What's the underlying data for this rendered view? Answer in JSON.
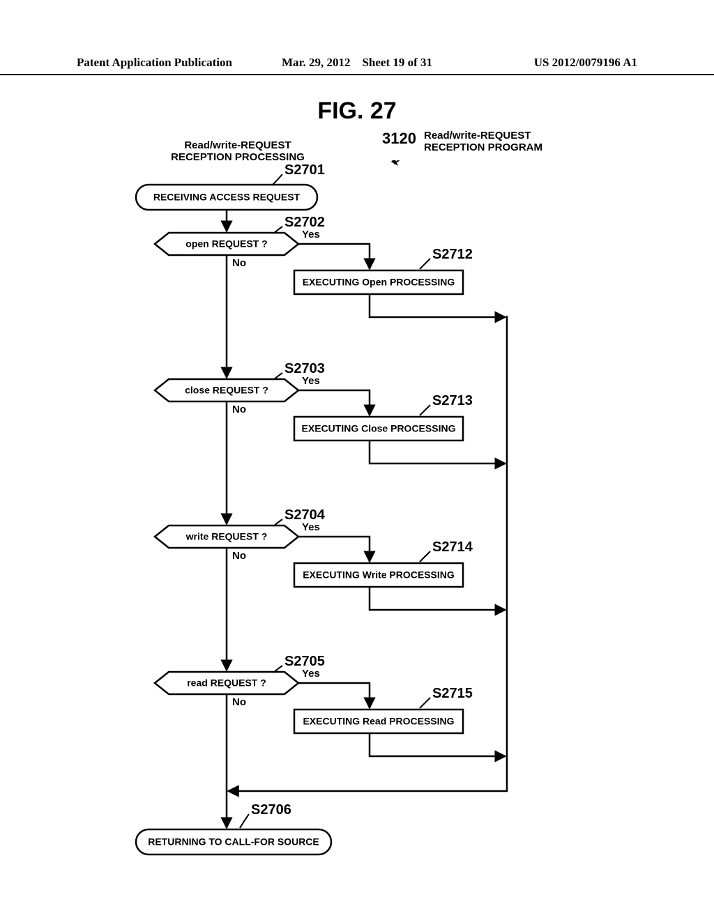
{
  "header": {
    "pub_type": "Patent Application Publication",
    "date": "Mar. 29, 2012",
    "sheet": "Sheet 19 of 31",
    "pub_no": "US 2012/0079196 A1"
  },
  "figure_title": "FIG. 27",
  "processing_title": "Read/write-REQUEST RECEPTION PROCESSING",
  "ref_number": "3120",
  "program_title": "Read/write-REQUEST RECEPTION PROGRAM",
  "steps": {
    "s2701": {
      "label": "S2701",
      "text": "RECEIVING ACCESS REQUEST"
    },
    "s2702": {
      "label": "S2702",
      "text": "open REQUEST ?"
    },
    "s2703": {
      "label": "S2703",
      "text": "close REQUEST ?"
    },
    "s2704": {
      "label": "S2704",
      "text": "write REQUEST ?"
    },
    "s2705": {
      "label": "S2705",
      "text": "read REQUEST ?"
    },
    "s2706": {
      "label": "S2706",
      "text": "RETURNING TO CALL-FOR SOURCE"
    },
    "s2712": {
      "label": "S2712",
      "text": "EXECUTING Open PROCESSING"
    },
    "s2713": {
      "label": "S2713",
      "text": "EXECUTING Close PROCESSING"
    },
    "s2714": {
      "label": "S2714",
      "text": "EXECUTING Write PROCESSING"
    },
    "s2715": {
      "label": "S2715",
      "text": "EXECUTING Read PROCESSING"
    }
  },
  "labels": {
    "yes": "Yes",
    "no": "No"
  }
}
